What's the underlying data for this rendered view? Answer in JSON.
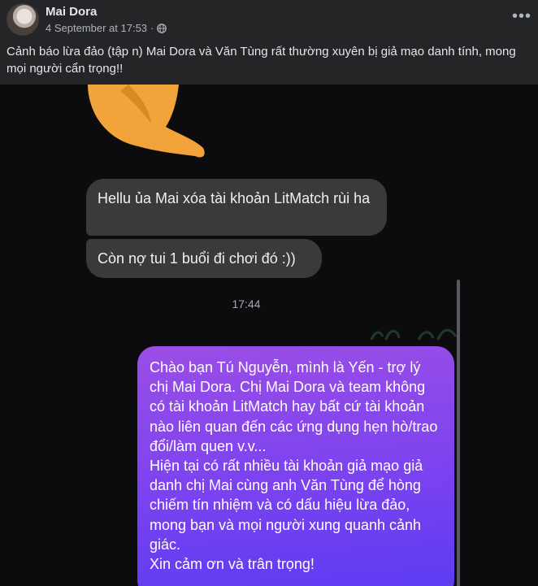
{
  "post": {
    "author": "Mai Dora",
    "timestamp": "4 September at 17:53",
    "separator": "·",
    "more_icon": "ellipsis-icon",
    "privacy_icon": "globe-icon",
    "text": "Cảnh báo lừa đảo (tập n) Mai Dora và Văn Tùng rất thường xuyên bị giả mạo danh tính, mong mọi người cẩn trọng!!"
  },
  "chat": {
    "incoming": [
      "Hellu ủa Mai xóa tài khoản LitMatch rùi ha",
      "Còn nợ tui 1 buổi đi chơi đó :))"
    ],
    "time": "17:44",
    "outgoing": [
      "Chào bạn Tú Nguyễn, mình là Yến - trợ lý chị Mai Dora. Chị Mai Dora và team không có tài khoản LitMatch hay bất cứ tài khoản nào liên quan đến các ứng dụng hẹn hò/trao đổi/làm quen v.v...",
      "Hiện tại có rất nhiều tài khoản giả mạo giả danh chị Mai cùng anh Văn Tùng để hòng chiếm tín nhiệm và có dấu hiệu lừa đảo, mong bạn và mọi người xung quanh cảnh giác.",
      "Xin cảm ơn và trân trọng!"
    ]
  },
  "colors": {
    "background": "#242526",
    "chat_background": "#0c0c0e",
    "incoming_bubble": "#3a3a3c",
    "outgoing_bubble_start": "#9b4ee6",
    "outgoing_bubble_end": "#5a3bf2",
    "sticker": "#f2a33a"
  }
}
